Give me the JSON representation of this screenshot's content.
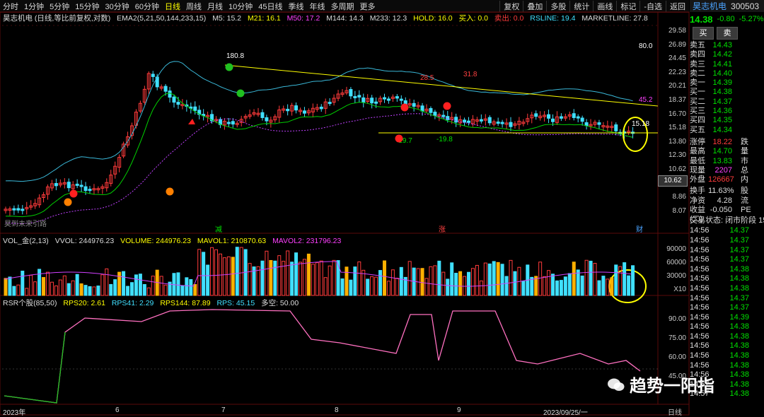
{
  "toolbar": {
    "tabs": [
      "分时",
      "1分钟",
      "5分钟",
      "15分钟",
      "30分钟",
      "60分钟",
      "日线",
      "周线",
      "月线",
      "10分钟",
      "45日线",
      "季线",
      "年线",
      "多周期",
      "更多"
    ],
    "active_tab": "日线",
    "buttons": [
      "复权",
      "叠加",
      "多股",
      "统计",
      "画线",
      "标记",
      "-自选",
      "返回"
    ]
  },
  "stock": {
    "name": "昊志机电",
    "code": "300503",
    "price": "14.38",
    "change": "-0.80",
    "pct": "-5.27%"
  },
  "legend": {
    "title": "昊志机电 (日线,等比前复权,对数)",
    "ema": "EMA2(5,21,50,144,233,15)",
    "m5": "M5: 15.2",
    "m21": "M21: 16.1",
    "m50": "M50: 17.2",
    "m144": "M144: 14.3",
    "m233": "M233: 12.3",
    "hold": "HOLD: 16.0",
    "buy": "买入: 0.0",
    "sell": "卖出: 0.0",
    "rsline": "RSLINE: 19.4",
    "marketline": "MARKETLINE: 27.8"
  },
  "price_axis": [
    "29.58",
    "26.89",
    "24.45",
    "22.23",
    "20.21",
    "18.37",
    "16.70",
    "15.18",
    "13.80",
    "12.30",
    "10.62",
    "9.96",
    "8.86",
    "8.07"
  ],
  "current_tag": "10.62",
  "chart_notes": {
    "high1": "180.8",
    "n285": "28.5",
    "n318": "31.8",
    "n452": "45.2",
    "n800": "80.0",
    "low1": "-19.7",
    "low2": "-19.8",
    "n1518": "15.18",
    "bottom_left": "昊到未来引路"
  },
  "markers": {
    "m1": "减",
    "m2": "涨",
    "m3": "财"
  },
  "vol_legend": {
    "name": "VOL_金(2,13)",
    "vvol": "VVOL: 244976.23",
    "volume": "VOLUME: 244976.23",
    "mavol1": "MAVOL1: 210870.63",
    "mavol2": "MAVOL2: 231796.23"
  },
  "vol_axis": [
    "90000",
    "60000",
    "30000",
    "X10"
  ],
  "rsr_legend": {
    "name": "RSR个股(85,50)",
    "rps20": "RPS20: 2.61",
    "rps41": "RPS41: 2.29",
    "rps144": "RPS144: 87.89",
    "rps": "RPS: 45.15",
    "duo": "多空: 50.00"
  },
  "rsr_axis": [
    "90.00",
    "75.00",
    "60.00",
    "45.00"
  ],
  "date_axis": [
    "2023年",
    "6",
    "7",
    "8",
    "9",
    "2023/09/25/一"
  ],
  "date_axis_right": "日线",
  "watermark": "趋势一阳指",
  "order_book": [
    {
      "label": "卖五",
      "price": "14.43"
    },
    {
      "label": "卖四",
      "price": "14.42"
    },
    {
      "label": "卖三",
      "price": "14.41"
    },
    {
      "label": "卖二",
      "price": "14.40"
    },
    {
      "label": "卖一",
      "price": "14.39"
    },
    {
      "label": "买一",
      "price": "14.38"
    },
    {
      "label": "买二",
      "price": "14.37"
    },
    {
      "label": "买三",
      "price": "14.36"
    },
    {
      "label": "买四",
      "price": "14.35"
    },
    {
      "label": "买五",
      "price": "14.34"
    }
  ],
  "buy_label": "买",
  "sell_label": "卖",
  "stats": [
    {
      "label": "涨停",
      "value": "18.22",
      "x": "跌"
    },
    {
      "label": "最高",
      "value": "14.70",
      "x": "量"
    },
    {
      "label": "最低",
      "value": "13.83",
      "x": "市"
    },
    {
      "label": "现量",
      "value": "2207",
      "x": "总"
    },
    {
      "label": "外盘",
      "value": "126667",
      "x": "内"
    }
  ],
  "stats2": [
    {
      "label": "换手",
      "value": "11.63%",
      "x": "股"
    },
    {
      "label": "净资",
      "value": "4.28",
      "x": "流"
    },
    {
      "label": "收益(二)",
      "value": "-0.050",
      "x": "PE"
    }
  ],
  "trade_status": "交易状态: 闭市阶段 15",
  "ticks": [
    {
      "t": "14:56",
      "p": "14.37"
    },
    {
      "t": "14:56",
      "p": "14.37"
    },
    {
      "t": "14:56",
      "p": "14.37"
    },
    {
      "t": "14:56",
      "p": "14.37"
    },
    {
      "t": "14:56",
      "p": "14.38"
    },
    {
      "t": "14:56",
      "p": "14.38"
    },
    {
      "t": "14:56",
      "p": "14.38"
    },
    {
      "t": "14:56",
      "p": "14.37"
    },
    {
      "t": "14:56",
      "p": "14.37"
    },
    {
      "t": "14:56",
      "p": "14.39"
    },
    {
      "t": "14:56",
      "p": "14.38"
    },
    {
      "t": "14:56",
      "p": "14.38"
    },
    {
      "t": "14:56",
      "p": "14.38"
    },
    {
      "t": "14:56",
      "p": "14.38"
    },
    {
      "t": "14:56",
      "p": "14.38"
    },
    {
      "t": "14:56",
      "p": "14.38"
    },
    {
      "t": "14:57",
      "p": "14.38"
    },
    {
      "t": "14:57",
      "p": "14.38"
    }
  ],
  "colors": {
    "up": "#ff3b3b",
    "down": "#40e0ff",
    "ma_yellow": "#ffff00",
    "ma_magenta": "#d040ff",
    "green": "#00d000",
    "grid": "#5a0a0a"
  }
}
